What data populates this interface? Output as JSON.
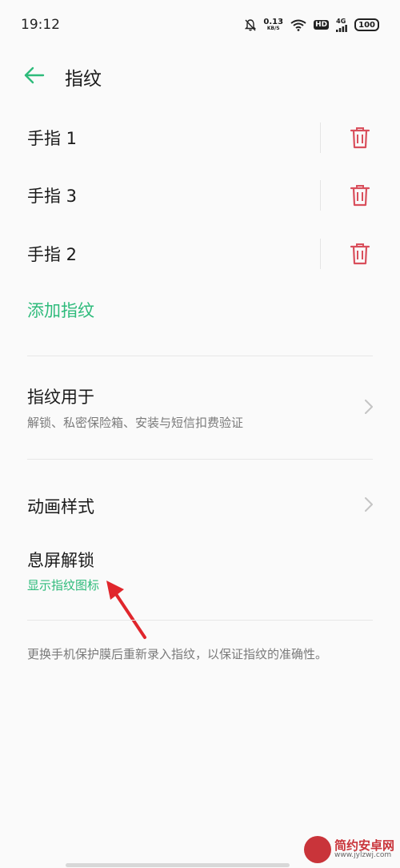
{
  "status_bar": {
    "time": "19:12",
    "speed_value": "0.13",
    "speed_unit": "KB/S",
    "hd": "HD",
    "network": "4G",
    "battery": "100"
  },
  "header": {
    "title": "指纹"
  },
  "fingerprints": [
    {
      "label": "手指 1"
    },
    {
      "label": "手指 3"
    },
    {
      "label": "手指 2"
    }
  ],
  "add_fingerprint_label": "添加指纹",
  "fingerprint_usage": {
    "title": "指纹用于",
    "subtitle": "解锁、私密保险箱、安装与短信扣费验证"
  },
  "animation_style": {
    "title": "动画样式"
  },
  "screen_off_unlock": {
    "title": "息屏解锁",
    "subtitle": "显示指纹图标"
  },
  "footer_note": "更换手机保护膜后重新录入指纹，以保证指纹的准确性。",
  "watermark": {
    "name": "简约安卓网",
    "url": "www.jylzwj.com"
  },
  "colors": {
    "accent": "#2ebb7b",
    "delete": "#d94f5c",
    "annotation_arrow": "#e0262c"
  }
}
